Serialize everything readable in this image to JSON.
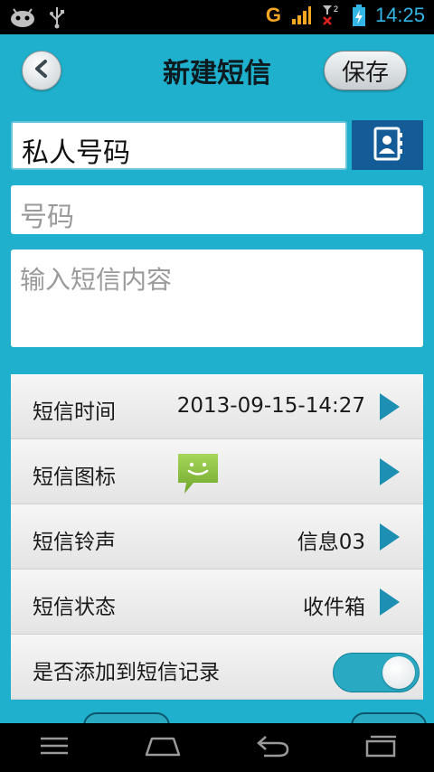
{
  "status_bar": {
    "network_label": "G",
    "clock": "14:25"
  },
  "header": {
    "title": "新建短信",
    "save_label": "保存"
  },
  "form": {
    "name_value": "私人号码",
    "number_placeholder": "号码",
    "content_placeholder": "输入短信内容"
  },
  "settings": {
    "time_label": "短信时间",
    "time_value": "2013-09-15-14:27",
    "icon_label": "短信图标",
    "ringtone_label": "短信铃声",
    "ringtone_value": "信息03",
    "status_label": "短信状态",
    "status_value": "收件箱",
    "add_record_label": "是否添加到短信记录"
  },
  "colors": {
    "background": "#1eb0cc",
    "accent": "#1c8fb2",
    "contact_button": "#135c97",
    "message_icon": "#8bc53f"
  }
}
